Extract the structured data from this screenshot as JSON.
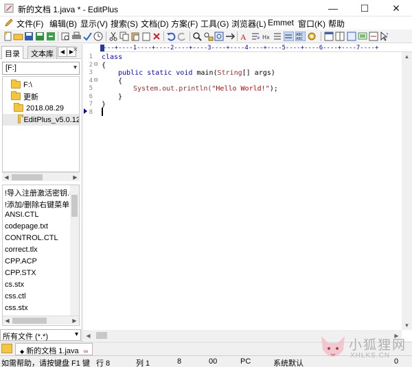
{
  "window": {
    "title": "新的文档 1.java * - EditPlus",
    "min_symbol": "—",
    "max_symbol": "☐",
    "close_symbol": "✕"
  },
  "menu": {
    "items": [
      "文件(F)",
      "编辑(B)",
      "显示(V)",
      "搜索(S)",
      "文档(D)",
      "方案(F)",
      "工具(G)",
      "浏览器(L)",
      "Emmet",
      "窗口(K)",
      "帮助"
    ]
  },
  "left_panel": {
    "tabs": [
      "目录",
      "文本库"
    ],
    "tab_arrows": [
      "◀",
      "▶",
      "✕"
    ],
    "drive": "[F:]",
    "dir_tree": [
      "F:\\",
      "更新",
      "2018.08.29",
      "EditPlus_v5.0.12"
    ],
    "files": [
      "!导入注册激活密钥.re",
      "!添加/删除右键菜单.b",
      "ANSI.CTL",
      "codepage.txt",
      "CONTROL.CTL",
      "correct.tlx",
      "CPP.ACP",
      "CPP.STX",
      "cs.stx",
      "css.ctl",
      "css.stx"
    ],
    "file_filter": "所有文件 (*.*)"
  },
  "editor": {
    "ruler": "----+----1----+----2----+----3----+----4----+----5----+----6----+----7----+",
    "line_numbers": [
      "1",
      "2",
      "3",
      "4",
      "5",
      "6",
      "7",
      "8"
    ],
    "fold_markers": [
      "",
      "⊟",
      "",
      "⊟",
      "",
      "",
      "",
      ""
    ],
    "code": {
      "l1": "class",
      "l2": "{",
      "l3_kw": "public static void",
      "l3_rest": " main(",
      "l3_type": "String",
      "l3_end": "[] args)",
      "l4": "{",
      "l5_call": "System.out.println(",
      "l5_str": "\"Hello World!\"",
      "l5_end": ");",
      "l6": "}",
      "l7": "}"
    }
  },
  "doc_tabs": [
    {
      "label": "新的文档 1.java",
      "dot": "◆",
      "close": "∞"
    }
  ],
  "status": {
    "help": "如需帮助，请按键盘 F1 键",
    "line": "行 8",
    "col": "列 1",
    "num": "8",
    "hex": "00",
    "platform": "PC",
    "encoding": "系统默认",
    "count": "0"
  },
  "watermark": {
    "title": "小狐狸网",
    "subtitle": "XHLKS.CN"
  },
  "colors": {
    "keyword": "#0000ff",
    "string": "#c80000",
    "type": "#a52a2a",
    "ruler": "#0000cc",
    "folder": "#f4c542"
  }
}
